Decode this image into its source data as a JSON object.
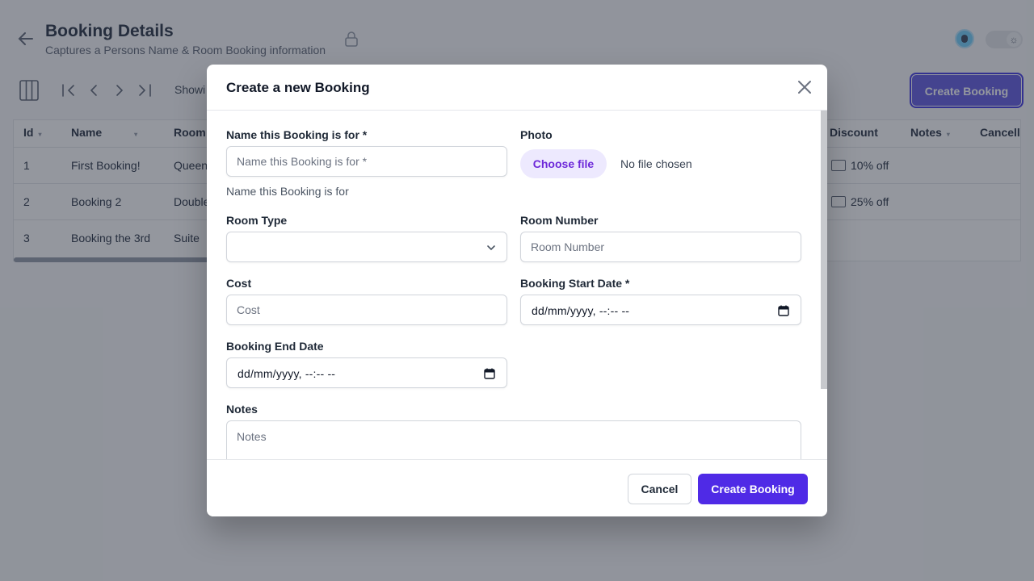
{
  "page": {
    "title": "Booking Details",
    "subtitle": "Captures a Persons Name & Room Booking information",
    "showing_text": "Showi",
    "create_button": "Create Booking"
  },
  "table": {
    "columns": [
      "Id",
      "Name",
      "Room",
      "Discount",
      "Notes",
      "Cancell"
    ],
    "rows": [
      {
        "id": "1",
        "name": "First Booking!",
        "room": "Queen",
        "discount": "10% off"
      },
      {
        "id": "2",
        "name": "Booking 2",
        "room": "Double",
        "discount": "25% off"
      },
      {
        "id": "3",
        "name": "Booking the 3rd",
        "room": "Suite",
        "discount": ""
      }
    ]
  },
  "modal": {
    "title": "Create a new Booking",
    "fields": {
      "name": {
        "label": "Name this Booking is for *",
        "placeholder": "Name this Booking is for *",
        "helper": "Name this Booking is for",
        "value": ""
      },
      "photo": {
        "label": "Photo",
        "button": "Choose file",
        "status": "No file chosen"
      },
      "room_type": {
        "label": "Room Type",
        "value": ""
      },
      "room_number": {
        "label": "Room Number",
        "placeholder": "Room Number",
        "value": ""
      },
      "cost": {
        "label": "Cost",
        "placeholder": "Cost",
        "value": ""
      },
      "start_date": {
        "label": "Booking Start Date *",
        "value": "dd/mm/yyyy, --:-- --"
      },
      "end_date": {
        "label": "Booking End Date",
        "value": "dd/mm/yyyy, --:-- --"
      },
      "notes": {
        "label": "Notes",
        "placeholder": "Notes",
        "value": ""
      }
    },
    "buttons": {
      "cancel": "Cancel",
      "create": "Create Booking"
    }
  },
  "colors": {
    "primary": "#4f2ae6",
    "file_button_bg": "#ede9fe",
    "file_button_text": "#6d28d9"
  }
}
